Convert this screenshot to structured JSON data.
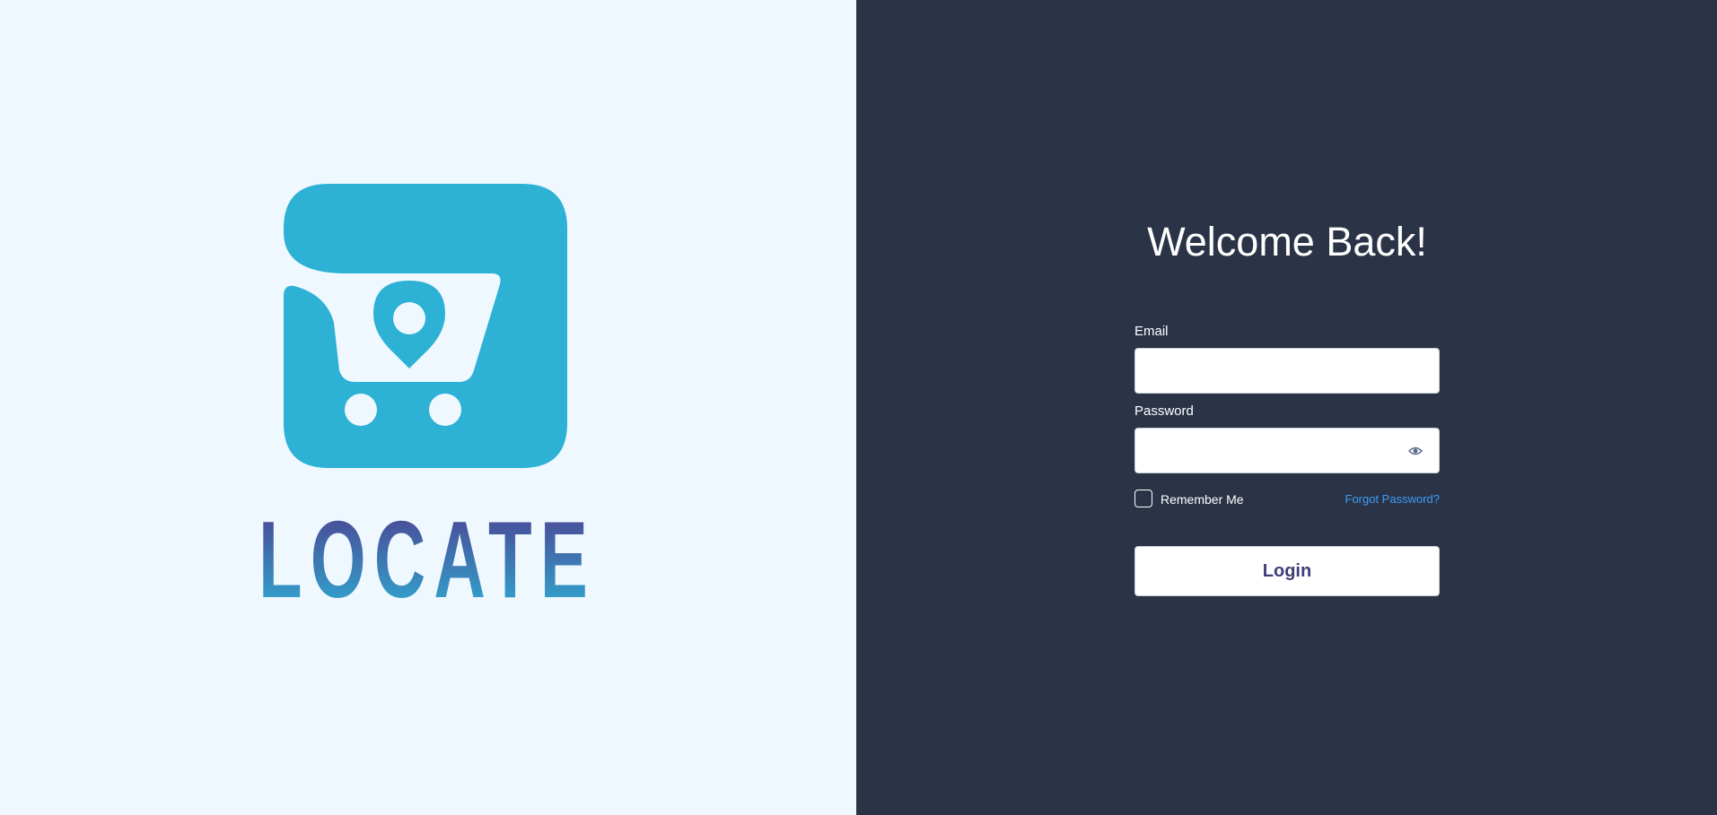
{
  "brand": {
    "name": "LOCATE",
    "colors": {
      "primary": "#2db1d4",
      "gradient_top": "#4f3b8e",
      "gradient_bottom": "#2db1d4",
      "left_background": "#eff8ff",
      "right_background": "#2b3447",
      "link": "#3b9cf7",
      "button_text": "#3f3d7a"
    }
  },
  "form": {
    "title": "Welcome Back!",
    "email": {
      "label": "Email",
      "value": "",
      "placeholder": ""
    },
    "password": {
      "label": "Password",
      "value": "",
      "placeholder": "",
      "toggle_icon": "eye-icon"
    },
    "remember_me": {
      "label": "Remember Me",
      "checked": false
    },
    "forgot_password": "Forgot Password?",
    "login_button": "Login"
  }
}
